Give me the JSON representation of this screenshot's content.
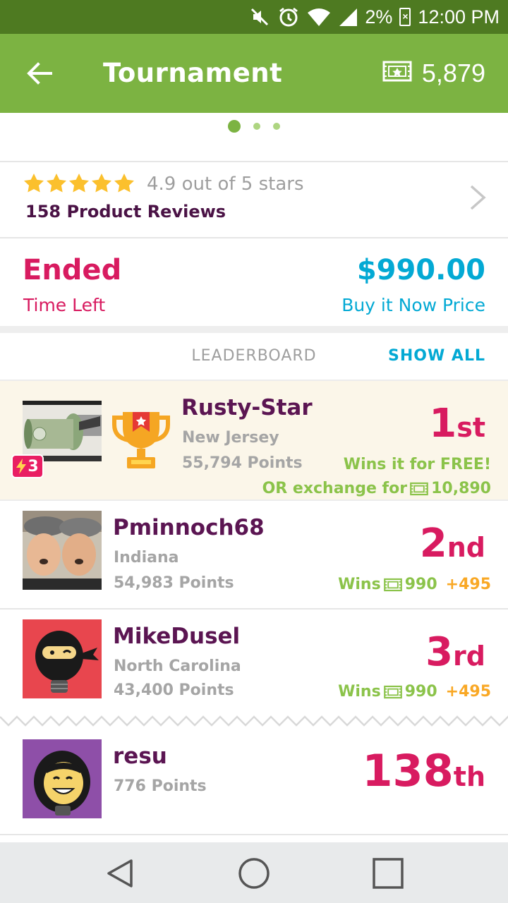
{
  "status_bar": {
    "battery": "2%",
    "time": "12:00 PM",
    "icons": [
      "mute-icon",
      "alarm-icon",
      "wifi-icon",
      "signal-icon",
      "battery-icon"
    ]
  },
  "app_bar": {
    "title": "Tournament",
    "balance": "5,879",
    "icons": [
      "back-arrow-icon",
      "ticket-icon"
    ]
  },
  "pager": {
    "pages": 3,
    "active": 0
  },
  "reviews": {
    "stars": 5,
    "rating_text": "4.9 out of 5 stars",
    "count_text": "158 Product Reviews"
  },
  "pricing": {
    "status": "Ended",
    "status_label": "Time Left",
    "price": "$990.00",
    "price_label": "Buy it Now Price"
  },
  "leaderboard": {
    "title": "LEADERBOARD",
    "show_all": "SHOW ALL",
    "entries": [
      {
        "name": "Rusty-Star",
        "location": "New Jersey",
        "points": "55,794 Points",
        "rank_num": "1",
        "rank_suffix": "st",
        "badge": "3",
        "prize_line1": "Wins it for FREE!",
        "prize_line2_prefix": "OR exchange for",
        "prize_line2_amount": "10,890"
      },
      {
        "name": "Pminnoch68",
        "location": "Indiana",
        "points": "54,983 Points",
        "rank_num": "2",
        "rank_suffix": "nd",
        "prize_prefix": "Wins",
        "prize_amount": "990",
        "prize_bonus": "+495"
      },
      {
        "name": "MikeDusel",
        "location": "North Carolina",
        "points": "43,400 Points",
        "rank_num": "3",
        "rank_suffix": "rd",
        "prize_prefix": "Wins",
        "prize_amount": "990",
        "prize_bonus": "+495"
      },
      {
        "name": "resu",
        "points": "776 Points",
        "rank_num": "138",
        "rank_suffix": "th"
      }
    ]
  },
  "colors": {
    "status_bar": "#4e7a21",
    "app_bar": "#7cb342",
    "magenta": "#d81b60",
    "cyan": "#03a9d4",
    "green": "#8bc34a",
    "orange": "#f9a825",
    "purple_text": "#5b1552"
  }
}
